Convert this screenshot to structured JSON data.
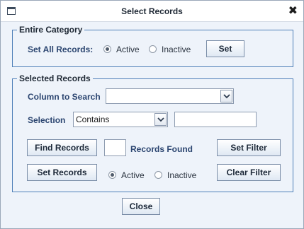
{
  "window": {
    "title": "Select Records",
    "close_glyph": "✖"
  },
  "entire_category": {
    "legend": "Entire Category",
    "set_all_label": "Set All Records:",
    "active_label": "Active",
    "inactive_label": "Inactive",
    "selected_option": "Active",
    "set_button": "Set"
  },
  "selected_records": {
    "legend": "Selected Records",
    "column_label": "Column to Search",
    "column_value": "",
    "selection_label": "Selection",
    "selection_value": "Contains",
    "selection_text": "",
    "find_button": "Find Records",
    "records_found_count": "",
    "records_found_label": "Records Found",
    "set_filter_button": "Set Filter",
    "set_records_button": "Set Records",
    "active_label": "Active",
    "inactive_label": "Inactive",
    "selected_option": "Active",
    "clear_filter_button": "Clear Filter"
  },
  "footer": {
    "close_button": "Close"
  },
  "icons": {
    "window_icon": "window-icon",
    "dropdown": "chevron-down-icon"
  }
}
